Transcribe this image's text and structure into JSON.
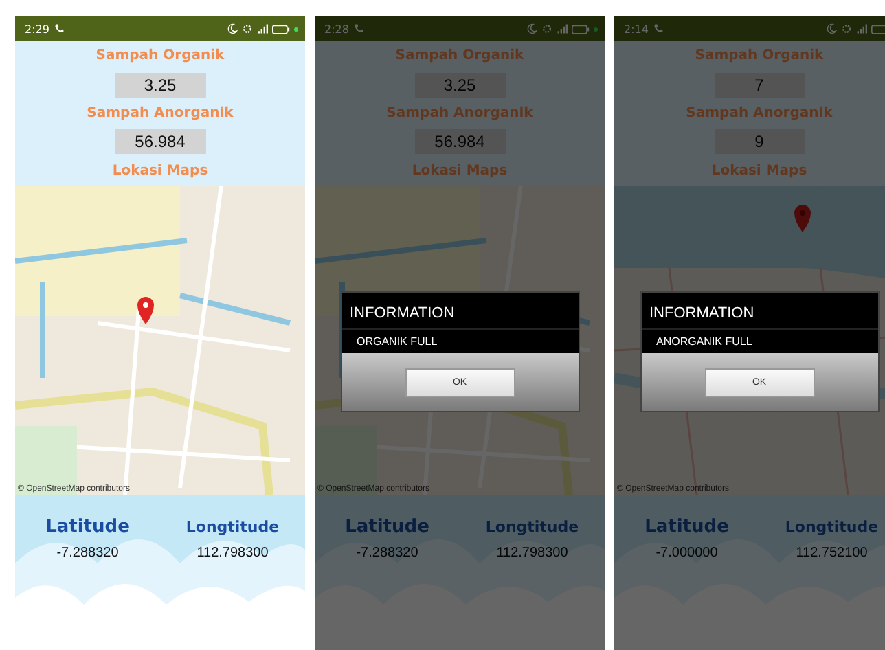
{
  "phones": [
    {
      "status_bar": {
        "time": "2:29"
      },
      "organic_label": "Sampah Organik",
      "organic_value": "3.25",
      "inorganic_label": "Sampah Anorganik",
      "inorganic_value": "56.984",
      "map_label": "Lokasi Maps",
      "map": {
        "attribution": "© OpenStreetMap contributors"
      },
      "latitude_label": "Latitude",
      "longitude_label": "Longtitude",
      "latitude": "-7.288320",
      "longitude": "112.798300"
    },
    {
      "status_bar": {
        "time": "2:28"
      },
      "organic_label": "Sampah Organik",
      "organic_value": "3.25",
      "inorganic_label": "Sampah Anorganik",
      "inorganic_value": "56.984",
      "map_label": "Lokasi Maps",
      "map": {
        "attribution": "© OpenStreetMap contributors"
      },
      "latitude_label": "Latitude",
      "longitude_label": "Longtitude",
      "latitude": "-7.288320",
      "longitude": "112.798300",
      "dialog": {
        "title": "INFORMATION",
        "message": "ORGANIK FULL",
        "button": "OK"
      }
    },
    {
      "status_bar": {
        "time": "2:14"
      },
      "organic_label": "Sampah Organik",
      "organic_value": "7",
      "inorganic_label": "Sampah Anorganik",
      "inorganic_value": "9",
      "map_label": "Lokasi Maps",
      "map": {
        "attribution": "© OpenStreetMap contributors"
      },
      "latitude_label": "Latitude",
      "longitude_label": "Longtitude",
      "latitude": "-7.000000",
      "longitude": "112.752100",
      "dialog": {
        "title": "INFORMATION",
        "message": "ANORGANIK FULL",
        "button": "OK"
      }
    }
  ]
}
